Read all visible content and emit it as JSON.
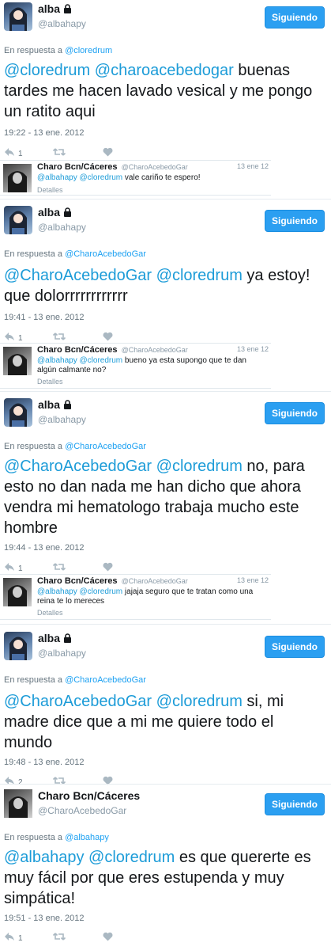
{
  "tweets": [
    {
      "name": "alba",
      "protected": true,
      "handle": "@albahapy",
      "follow_label": "Siguiendo",
      "reply_prefix": "En respuesta a",
      "reply_to": "@cloredrum",
      "mention1": "@cloredrum",
      "mention2": "@charoacebedogar",
      "text": "  buenas tardes me hacen lavado vesical y me pongo un ratito aqui",
      "time": "19:22 - 13 ene. 2012",
      "reply_count": "1",
      "retweet_count": "",
      "quote": {
        "name": "Charo Bcn/Cáceres",
        "handle": "@CharoAcebedoGar",
        "date": "13 ene 12",
        "mention1": "@albahapy",
        "mention2": "@cloredrum",
        "text": " vale cariño te espero!",
        "details": "Detalles"
      }
    },
    {
      "name": "alba",
      "protected": true,
      "handle": "@albahapy",
      "follow_label": "Siguiendo",
      "reply_prefix": "En respuesta a",
      "reply_to": "@CharoAcebedoGar",
      "mention1": "@CharoAcebedoGar",
      "mention2": "@cloredrum",
      "text": " ya estoy! que dolorrrrrrrrrrrr",
      "time": "19:41 - 13 ene. 2012",
      "reply_count": "1",
      "retweet_count": "",
      "quote": {
        "name": "Charo Bcn/Cáceres",
        "handle": "@CharoAcebedoGar",
        "date": "13 ene 12",
        "mention1": "@albahapy",
        "mention2": "@cloredrum",
        "text": " bueno ya esta supongo que te dan algún calmante no?",
        "details": "Detalles"
      }
    },
    {
      "name": "alba",
      "protected": true,
      "handle": "@albahapy",
      "follow_label": "Siguiendo",
      "reply_prefix": "En respuesta a",
      "reply_to": "@CharoAcebedoGar",
      "mention1": "@CharoAcebedoGar",
      "mention2": "@cloredrum",
      "text": " no, para esto no dan nada me han dicho que ahora vendra mi hematologo trabaja mucho este hombre",
      "time": "19:44 - 13 ene. 2012",
      "reply_count": "1",
      "retweet_count": "",
      "quote": {
        "name": "Charo Bcn/Cáceres",
        "handle": "@CharoAcebedoGar",
        "date": "13 ene 12",
        "mention1": "@albahapy",
        "mention2": "@cloredrum",
        "text": " jajaja seguro que te tratan como una reina te lo mereces",
        "details": "Detalles"
      }
    },
    {
      "name": "alba",
      "protected": true,
      "handle": "@albahapy",
      "follow_label": "Siguiendo",
      "reply_prefix": "En respuesta a",
      "reply_to": "@CharoAcebedoGar",
      "mention1": "@CharoAcebedoGar",
      "mention2": "@cloredrum",
      "text": " si, mi madre dice que a mi me quiere todo el mundo",
      "time": "19:48 - 13 ene. 2012",
      "reply_count": "2",
      "retweet_count": ""
    },
    {
      "name": "Charo Bcn/Cáceres",
      "protected": false,
      "handle": "@CharoAcebedoGar",
      "follow_label": "Siguiendo",
      "reply_prefix": "En respuesta a",
      "reply_to": "@albahapy",
      "mention1": "@albahapy",
      "mention2": "@cloredrum",
      "text": " es que quererte es muy fácil por que eres estupenda y muy simpática!",
      "time": "19:51 - 13 ene. 2012",
      "reply_count": "1",
      "retweet_count": ""
    }
  ],
  "icons": [
    "lock-icon",
    "reply-icon",
    "retweet-icon",
    "like-icon"
  ],
  "colors": {
    "link": "#1d9cd8",
    "button": "#2b9ff1",
    "muted": "#66757f"
  }
}
